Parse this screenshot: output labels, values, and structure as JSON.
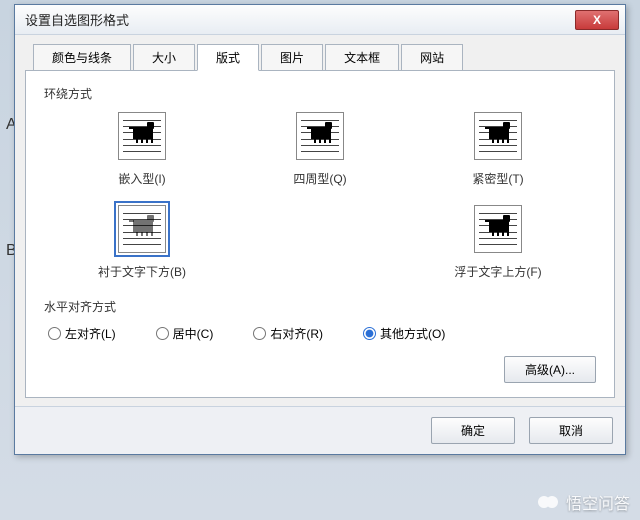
{
  "dialog": {
    "title": "设置自选图形格式",
    "close_glyph": "X"
  },
  "tabs": {
    "items": [
      {
        "label": "颜色与线条"
      },
      {
        "label": "大小"
      },
      {
        "label": "版式",
        "active": true
      },
      {
        "label": "图片"
      },
      {
        "label": "文本框"
      },
      {
        "label": "网站"
      }
    ]
  },
  "wrap": {
    "group_label": "环绕方式",
    "options": [
      {
        "label": "嵌入型(I)",
        "kind": "inline"
      },
      {
        "label": "四周型(Q)",
        "kind": "square"
      },
      {
        "label": "紧密型(T)",
        "kind": "tight"
      },
      {
        "label": "衬于文字下方(B)",
        "kind": "behind",
        "selected": true
      },
      {
        "label": "浮于文字上方(F)",
        "kind": "front"
      }
    ]
  },
  "halign": {
    "group_label": "水平对齐方式",
    "options": [
      {
        "label": "左对齐(L)"
      },
      {
        "label": "居中(C)"
      },
      {
        "label": "右对齐(R)"
      },
      {
        "label": "其他方式(O)",
        "checked": true
      }
    ]
  },
  "buttons": {
    "advanced": "高级(A)...",
    "ok": "确定",
    "cancel": "取消"
  },
  "background_letters": {
    "A": "A",
    "B": "B"
  },
  "watermark": "悟空问答"
}
